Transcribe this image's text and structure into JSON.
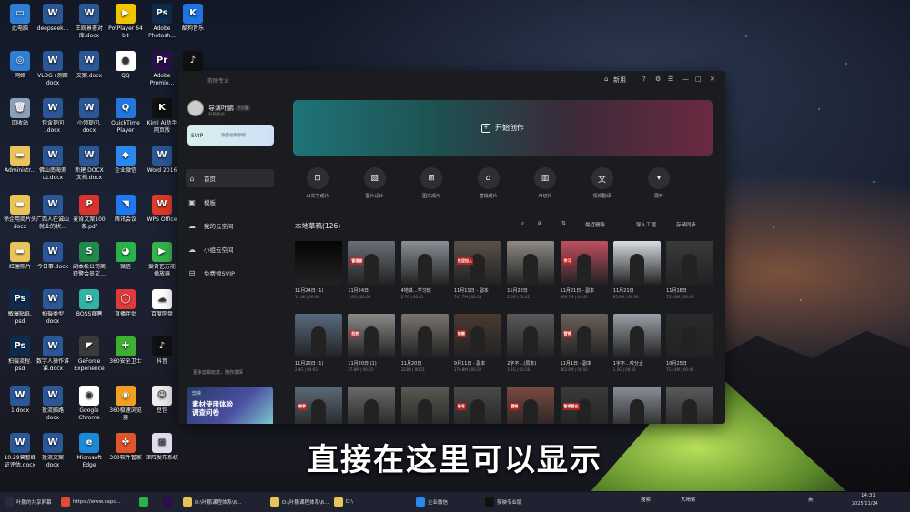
{
  "desktop": {
    "icons": [
      {
        "label": "此电脑",
        "col": 0,
        "row": 0,
        "color": "#2d7fd6",
        "glyph": "▭"
      },
      {
        "label": "deepseek...",
        "col": 1,
        "row": 0,
        "color": "#2b5797",
        "glyph": "W"
      },
      {
        "label": "王婉景署对\n库.docx",
        "col": 2,
        "row": 0,
        "color": "#2b5797",
        "glyph": "W"
      },
      {
        "label": "PotPlayer 64\nbit",
        "col": 3,
        "row": 0,
        "color": "#f2c500",
        "glyph": "▶"
      },
      {
        "label": "Adobe\nPhotosh...",
        "col": 4,
        "row": 0,
        "color": "#0d2b4d",
        "glyph": "Ps"
      },
      {
        "label": "酷狗音乐",
        "col": 5,
        "row": 0,
        "color": "#1f74e0",
        "glyph": "K"
      },
      {
        "label": "网络",
        "col": 0,
        "row": 1,
        "color": "#2d7fd6",
        "glyph": "◎"
      },
      {
        "label": "VLOG+测面\ndocx",
        "col": 1,
        "row": 1,
        "color": "#2b5797",
        "glyph": "W"
      },
      {
        "label": "文案.docx",
        "col": 2,
        "row": 1,
        "color": "#2b5797",
        "glyph": "W"
      },
      {
        "label": "QQ",
        "col": 3,
        "row": 1,
        "color": "#ffffff",
        "glyph": "●"
      },
      {
        "label": "Adobe\nPremie...",
        "col": 4,
        "row": 1,
        "color": "#2a0f4a",
        "glyph": "Pr"
      },
      {
        "label": "",
        "col": 5,
        "row": 1,
        "color": "#111111",
        "glyph": "♪"
      },
      {
        "label": "回收站",
        "col": 0,
        "row": 2,
        "color": "#8aa0b8",
        "glyph": "🗑"
      },
      {
        "label": "包含提问\n.docx",
        "col": 1,
        "row": 2,
        "color": "#2b5797",
        "glyph": "W"
      },
      {
        "label": "小领提问.\ndocx",
        "col": 2,
        "row": 2,
        "color": "#2b5797",
        "glyph": "W"
      },
      {
        "label": "QuickTime\nPlayer",
        "col": 3,
        "row": 2,
        "color": "#2277dd",
        "glyph": "Q"
      },
      {
        "label": "Kimi AI助手\n网页版",
        "col": 4,
        "row": 2,
        "color": "#111111",
        "glyph": "K"
      },
      {
        "label": "Administr...",
        "col": 0,
        "row": 3,
        "color": "#e8c45a",
        "glyph": "▬"
      },
      {
        "label": "佛山南海测\n山.docx",
        "col": 1,
        "row": 3,
        "color": "#2b5797",
        "glyph": "W"
      },
      {
        "label": "新建 DOCX\n文档.docx",
        "col": 2,
        "row": 3,
        "color": "#2b5797",
        "glyph": "W"
      },
      {
        "label": "企业微信",
        "col": 3,
        "row": 3,
        "color": "#2a88f0",
        "glyph": "◆"
      },
      {
        "label": "Word 2016",
        "col": 4,
        "row": 3,
        "color": "#2b5797",
        "glyph": "W"
      },
      {
        "label": "徐企用商片头\ndocx",
        "col": 0,
        "row": 4,
        "color": "#e8c45a",
        "glyph": "▬"
      },
      {
        "label": "广西人在诚山\n就业的状…",
        "col": 1,
        "row": 4,
        "color": "#2b5797",
        "glyph": "W"
      },
      {
        "label": "麦肯文案100\n条.pdf",
        "col": 2,
        "row": 4,
        "color": "#d9342b",
        "glyph": "P"
      },
      {
        "label": "腾讯会议",
        "col": 3,
        "row": 4,
        "color": "#1e78f0",
        "glyph": "◥"
      },
      {
        "label": "WPS Office",
        "col": 4,
        "row": 4,
        "color": "#e03a2a",
        "glyph": "W"
      },
      {
        "label": "红僵照片",
        "col": 0,
        "row": 5,
        "color": "#e8c45a",
        "glyph": "▬"
      },
      {
        "label": "今日事.docx",
        "col": 1,
        "row": 5,
        "color": "#2b5797",
        "glyph": "W"
      },
      {
        "label": "副本松公司商\n获警会员文…",
        "col": 2,
        "row": 5,
        "color": "#1f8a4a",
        "glyph": "S"
      },
      {
        "label": "微信",
        "col": 3,
        "row": 5,
        "color": "#2ab24a",
        "glyph": "◕"
      },
      {
        "label": "爱奇艺万能\n播放器",
        "col": 4,
        "row": 5,
        "color": "#35b34a",
        "glyph": "▶"
      },
      {
        "label": "敏爆贴纸.\npsd",
        "col": 0,
        "row": 6,
        "color": "#0d2b4d",
        "glyph": "Ps"
      },
      {
        "label": "拍摄类型\ndocx",
        "col": 1,
        "row": 6,
        "color": "#2b5797",
        "glyph": "W"
      },
      {
        "label": "BOSS直聘",
        "col": 2,
        "row": 6,
        "color": "#2fb5a5",
        "glyph": "B"
      },
      {
        "label": "直播伴侣",
        "col": 3,
        "row": 6,
        "color": "#e03a3a",
        "glyph": "◯"
      },
      {
        "label": "百度网盘",
        "col": 4,
        "row": 6,
        "color": "#ffffff",
        "glyph": "☁"
      },
      {
        "label": "拍摄流程.\npsd",
        "col": 0,
        "row": 7,
        "color": "#0d2b4d",
        "glyph": "Ps"
      },
      {
        "label": "数字人操作讲\n课.docx",
        "col": 1,
        "row": 7,
        "color": "#2b5797",
        "glyph": "W"
      },
      {
        "label": "GeForce\nExperience",
        "col": 2,
        "row": 7,
        "color": "#3a3a3a",
        "glyph": "◤"
      },
      {
        "label": "360安全卫士",
        "col": 3,
        "row": 7,
        "color": "#3cb030",
        "glyph": "✚"
      },
      {
        "label": "抖音",
        "col": 4,
        "row": 7,
        "color": "#111111",
        "glyph": "♪"
      },
      {
        "label": "1.docx",
        "col": 0,
        "row": 8,
        "color": "#2b5797",
        "glyph": "W"
      },
      {
        "label": "投流脑路\ndocx",
        "col": 1,
        "row": 8,
        "color": "#2b5797",
        "glyph": "W"
      },
      {
        "label": "Google\nChrome",
        "col": 2,
        "row": 8,
        "color": "#ffffff",
        "glyph": "◉"
      },
      {
        "label": "360极速浏览\n器",
        "col": 3,
        "row": 8,
        "color": "#f2a020",
        "glyph": "◉"
      },
      {
        "label": "豆包",
        "col": 4,
        "row": 8,
        "color": "#eeeeee",
        "glyph": "☺"
      },
      {
        "label": "10.29曾智峰\n证评估.docx",
        "col": 0,
        "row": 9,
        "color": "#2b5797",
        "glyph": "W"
      },
      {
        "label": "投流文案\ndocx",
        "col": 1,
        "row": 9,
        "color": "#2b5797",
        "glyph": "W"
      },
      {
        "label": "Microsoft\nEdge",
        "col": 2,
        "row": 9,
        "color": "#1a8ad8",
        "glyph": "e"
      },
      {
        "label": "360软件管家",
        "col": 3,
        "row": 9,
        "color": "#e0552a",
        "glyph": "✤"
      },
      {
        "label": "矩阵发布系统",
        "col": 4,
        "row": 9,
        "color": "#dde",
        "glyph": "⊞"
      }
    ]
  },
  "window": {
    "app_title": "剪映专业",
    "titlebar": {
      "icon1": "⌂",
      "feedback": "新用",
      "help": "?",
      "icon3": "⚙",
      "icon4": "☰",
      "minimize": "—",
      "maximize": "□",
      "close": "✕"
    },
    "user": {
      "name": "导演叶鹏",
      "badge": "个人版",
      "sub": "升级会员"
    },
    "svip": {
      "label": "SVIP",
      "promo": "限量福利领取"
    },
    "nav": [
      {
        "icon": "⌂",
        "label": "首页",
        "active": true
      },
      {
        "icon": "▣",
        "label": "模板",
        "active": false
      },
      {
        "icon": "☁",
        "label": "我的云空间",
        "active": false
      },
      {
        "icon": "☁",
        "label": "小组云空间",
        "active": false
      },
      {
        "icon": "⊟",
        "label": "免费领SVIP",
        "active": false
      }
    ],
    "footer_text": "更多剪辑玩法，随你发挥",
    "promo": {
      "tag": "剪映",
      "line1": "素材使用体验",
      "line2": "调查问卷"
    },
    "hero": {
      "label": "开始创作",
      "icon": "+"
    },
    "tools": [
      {
        "icon": "⊡",
        "label": "AI文字成片"
      },
      {
        "icon": "▨",
        "label": "图片设计"
      },
      {
        "icon": "⊞",
        "label": "图文成片"
      },
      {
        "icon": "⌂",
        "label": "营销成片"
      },
      {
        "icon": "▥",
        "label": "AI切片"
      },
      {
        "icon": "文",
        "label": "视频翻译"
      },
      {
        "icon": "▾",
        "label": "展开"
      }
    ],
    "drafts": {
      "heading": "本地草稿(126)",
      "toolbar": {
        "search": "⌕",
        "view": "⊞",
        "sort": "⇅",
        "recycle": "最近删除",
        "import": "导入工程",
        "batch": "存储同步"
      },
      "items": [
        {
          "title": "11月24日 (1)",
          "meta": "11.4K | 00:00",
          "bg": "#050505",
          "cap": ""
        },
        {
          "title": "11月24日",
          "meta": "1.6G | 00:09",
          "bg": "#6a6f78",
          "cap": "管理者"
        },
        {
          "title": "4地铁…学习班",
          "meta": "2.7G | 00:41",
          "bg": "#8a8f95",
          "cap": ""
        },
        {
          "title": "11月11日 - 副本",
          "meta": "747.7M | 00:28",
          "bg": "#5a5048",
          "cap": "欢迎加入"
        },
        {
          "title": "11月22日",
          "meta": "2.6G | 01:41",
          "bg": "#8d8a84",
          "cap": ""
        },
        {
          "title": "11月21日 - 副本",
          "meta": "909.7M | 00:41",
          "bg": "#c05060",
          "cap": "学习"
        },
        {
          "title": "11月21日",
          "meta": "85.9M | 00:09",
          "bg": "#d8dde3",
          "cap": ""
        },
        {
          "title": "11月18日",
          "meta": "753.6M | 00:00",
          "bg": "#3a3a3a",
          "cap": ""
        },
        {
          "title": "11月20日 (1)",
          "meta": "2.4G | 00:03",
          "bg": "#5a6a80",
          "cap": ""
        },
        {
          "title": "11月20日 (1)",
          "meta": "37.8M | 00:03",
          "bg": "#8a8a88",
          "cap": "投放"
        },
        {
          "title": "11月20日",
          "meta": "323M | 00:21",
          "bg": "#7a7570",
          "cap": ""
        },
        {
          "title": "9月11日 - 副本",
          "meta": "176.8M | 00:32",
          "bg": "#4a3a32",
          "cap": "拍摄"
        },
        {
          "title": "2字不…(原本)",
          "meta": "1.7G | 00:28",
          "bg": "#5a5a5a",
          "cap": ""
        },
        {
          "title": "11月1日 - 副本",
          "meta": "462.0M | 00:55",
          "bg": "#6a6258",
          "cap": "营销"
        },
        {
          "title": "1字不…咬分止",
          "meta": "1.5G | 00:22",
          "bg": "#9aa0a8",
          "cap": ""
        },
        {
          "title": "10月25日",
          "meta": "713.4M | 00:49",
          "bg": "#2a2a2a",
          "cap": ""
        },
        {
          "title": "",
          "meta": "",
          "bg": "#5a6a78",
          "cap": "做事"
        },
        {
          "title": "",
          "meta": "",
          "bg": "#6a6a6a",
          "cap": ""
        },
        {
          "title": "",
          "meta": "",
          "bg": "#5a5a52",
          "cap": ""
        },
        {
          "title": "",
          "meta": "",
          "bg": "#4a4a4a",
          "cap": "账号"
        },
        {
          "title": "",
          "meta": "",
          "bg": "#7a4a40",
          "cap": "营销"
        },
        {
          "title": "",
          "meta": "",
          "bg": "#3a3a3a",
          "cap": "暂停营业"
        },
        {
          "title": "",
          "meta": "",
          "bg": "#8a9098",
          "cap": ""
        },
        {
          "title": "",
          "meta": "",
          "bg": "#5a5a5a",
          "cap": ""
        }
      ]
    }
  },
  "subtitle": "直接在这里可以显示",
  "taskbar": {
    "items": [
      {
        "label": "叶鹏的共享屏幕",
        "color": "#2a2d3a"
      },
      {
        "label": "https://www.capc...",
        "color": "#e04a3a"
      },
      {
        "label": "",
        "color": "#2ab24a"
      },
      {
        "label": "",
        "color": "#2a0f4a"
      },
      {
        "label": "D:\\叶鹏课程体系\\6...",
        "color": "#e8c45a"
      },
      {
        "label": "D:\\叶鹏课程体系\\6...",
        "color": "#e8c45a"
      },
      {
        "label": "D:\\",
        "color": "#e8c45a"
      },
      {
        "label": "企业微信",
        "color": "#2a88f0"
      },
      {
        "label": "剪映专业版",
        "color": "#111111"
      }
    ],
    "tray": {
      "search": "搜索",
      "weather": "大晴转",
      "ime": "英",
      "time": "14:31",
      "date": "2025/11/24"
    }
  }
}
